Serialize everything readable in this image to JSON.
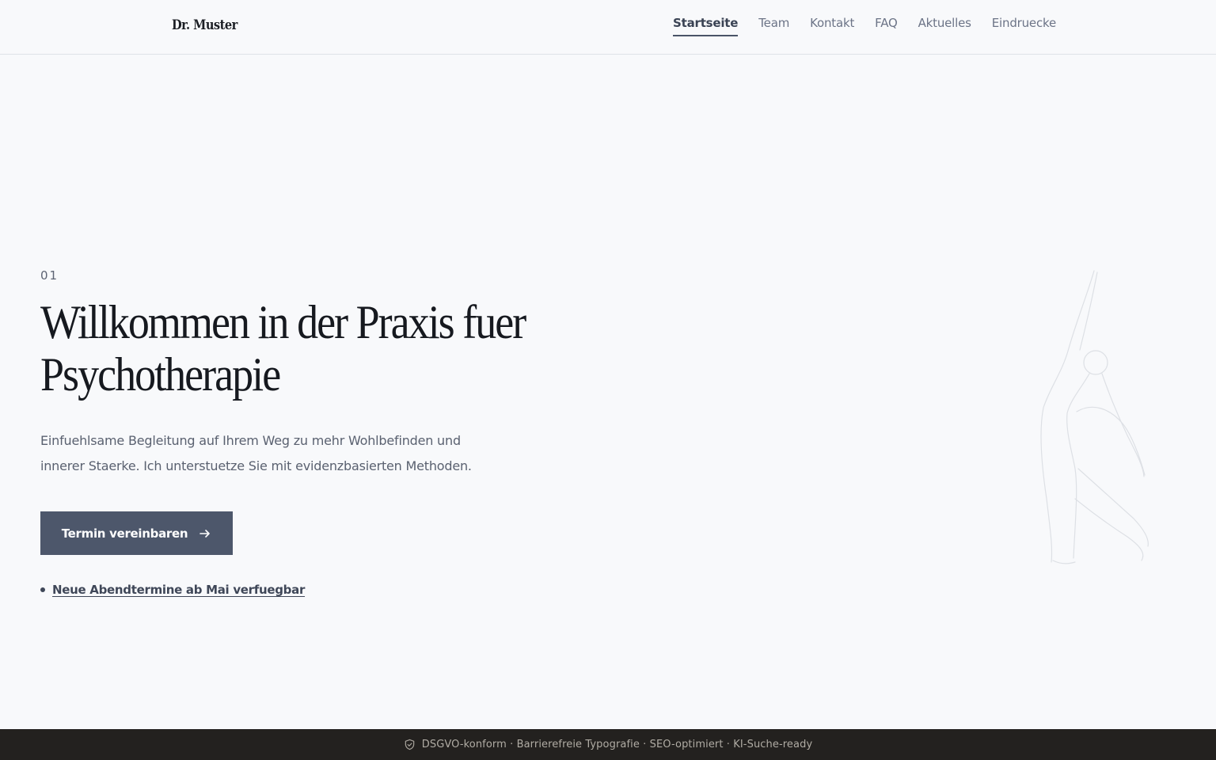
{
  "header": {
    "logo": "Dr. Muster",
    "nav": [
      {
        "label": "Startseite",
        "active": true
      },
      {
        "label": "Team"
      },
      {
        "label": "Kontakt"
      },
      {
        "label": "FAQ"
      },
      {
        "label": "Aktuelles"
      },
      {
        "label": "Eindruecke"
      }
    ]
  },
  "hero": {
    "index": "01",
    "title_line1": "Willkommen in der Praxis fuer",
    "title_line2": "Psychotherapie",
    "text": "Einfuehlsame Begleitung auf Ihrem Weg zu mehr Wohlbefinden und innerer Staerke. Ich unterstuetze Sie mit evidenzbasierten Methoden.",
    "cta_label": "Termin vereinbaren",
    "cta_icon": "arrow-right-icon",
    "notice": "Neue Abendtermine ab Mai verfuegbar"
  },
  "footer": {
    "icon": "shield-check-icon",
    "text": "DSGVO-konform · Barrierefreie Typografie · SEO-optimiert · KI-Suche-ready"
  },
  "colors": {
    "background": "#f8f9fb",
    "accent": "#4d576b",
    "footer_bg": "#23211f"
  }
}
